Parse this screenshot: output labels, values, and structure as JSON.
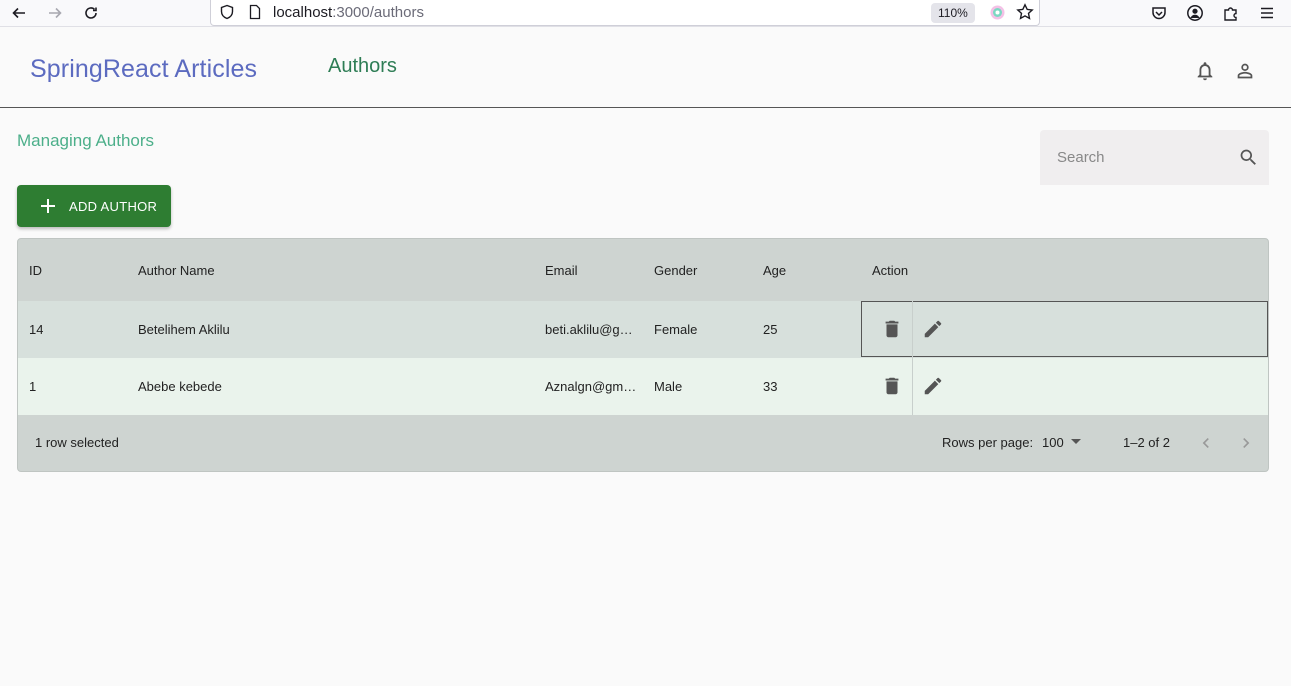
{
  "browser": {
    "url_host": "localhost",
    "url_path": ":3000/authors",
    "zoom": "110%"
  },
  "header": {
    "brand": "SpringReact Articles",
    "nav_link": "Authors"
  },
  "page": {
    "title": "Managing Authors",
    "search_placeholder": "Search",
    "add_button_label": "ADD AUTHOR"
  },
  "table": {
    "columns": [
      "ID",
      "Author Name",
      "Email",
      "Gender",
      "Age",
      "Action"
    ],
    "rows": [
      {
        "id": "14",
        "name": "Betelihem Aklilu",
        "email": "beti.aklilu@g…",
        "gender": "Female",
        "age": "25"
      },
      {
        "id": "1",
        "name": "Abebe kebede",
        "email": "Aznalgn@gm…",
        "gender": "Male",
        "age": "33"
      }
    ],
    "footer": {
      "selection": "1 row selected",
      "rows_per_page_label": "Rows per page:",
      "rows_per_page_value": "100",
      "range": "1–2 of 2"
    }
  },
  "icons": {
    "delete": "trash-icon",
    "edit": "pencil-icon",
    "notifications": "bell-icon",
    "account": "person-icon",
    "search": "search-icon"
  },
  "colors": {
    "brand": "#5c6bc0",
    "nav": "#2e7d55",
    "title": "#4caf8a",
    "add_button": "#2e7d32"
  }
}
